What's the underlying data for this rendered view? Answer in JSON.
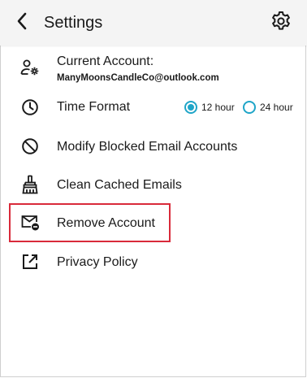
{
  "header": {
    "title": "Settings",
    "back_icon": "chevron-left-icon",
    "settings_icon": "gear-icon"
  },
  "settings": {
    "current_account": {
      "label": "Current Account:",
      "email": "ManyMoonsCandleCo@outlook.com",
      "icon": "account-settings-icon"
    },
    "time_format": {
      "label": "Time Format",
      "icon": "clock-icon",
      "options": [
        {
          "label": "12 hour",
          "selected": true
        },
        {
          "label": "24 hour",
          "selected": false
        }
      ]
    },
    "blocked": {
      "label": "Modify Blocked Email Accounts",
      "icon": "block-icon"
    },
    "clean_cache": {
      "label": "Clean Cached Emails",
      "icon": "broom-icon"
    },
    "remove_account": {
      "label": "Remove Account",
      "icon": "mail-remove-icon"
    },
    "privacy": {
      "label": "Privacy Policy",
      "icon": "open-external-icon"
    }
  },
  "colors": {
    "accent": "#1fa5c8",
    "highlight": "#d92a3a",
    "header_bg": "#f4f4f4"
  }
}
